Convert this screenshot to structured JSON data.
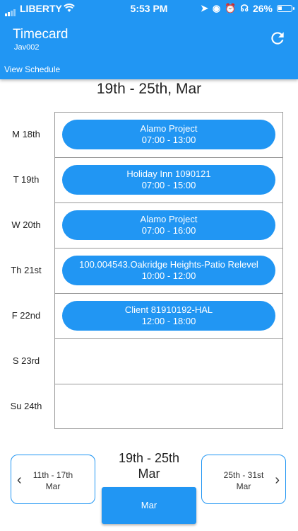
{
  "status_bar": {
    "carrier": "LIBERTY",
    "time": "5:53 PM",
    "battery": "26%",
    "battery_level": 0.26
  },
  "header": {
    "title": "Timecard",
    "subtitle": "Jav002",
    "refresh_icon": "refresh-icon",
    "view_schedule": "View Schedule"
  },
  "week_title": "19th - 25th, Mar",
  "days": [
    {
      "label": "M 18th",
      "shift": {
        "name": "Alamo Project",
        "time": "07:00 - 13:00"
      }
    },
    {
      "label": "T 19th",
      "shift": {
        "name": "Holiday Inn 1090121",
        "time": "07:00 - 15:00"
      }
    },
    {
      "label": "W 20th",
      "shift": {
        "name": "Alamo Project",
        "time": "07:00 - 16:00"
      }
    },
    {
      "label": "Th 21st",
      "shift": {
        "name": "100.004543.Oakridge Heights-Patio Relevel",
        "time": "10:00 - 12:00"
      }
    },
    {
      "label": "F 22nd",
      "shift": {
        "name": "Client 81910192-HAL",
        "time": "12:00 - 18:00"
      }
    },
    {
      "label": "S 23rd",
      "shift": null
    },
    {
      "label": "Su 24th",
      "shift": null
    }
  ],
  "nav": {
    "prev": {
      "line1": "11th - 17th",
      "line2": "Mar"
    },
    "current": {
      "line1": "19th - 25th",
      "line2": "Mar"
    },
    "next": {
      "line1": "25th - 31st",
      "line2": "Mar"
    },
    "month_button": "Mar"
  },
  "colors": {
    "accent": "#2196f3"
  }
}
